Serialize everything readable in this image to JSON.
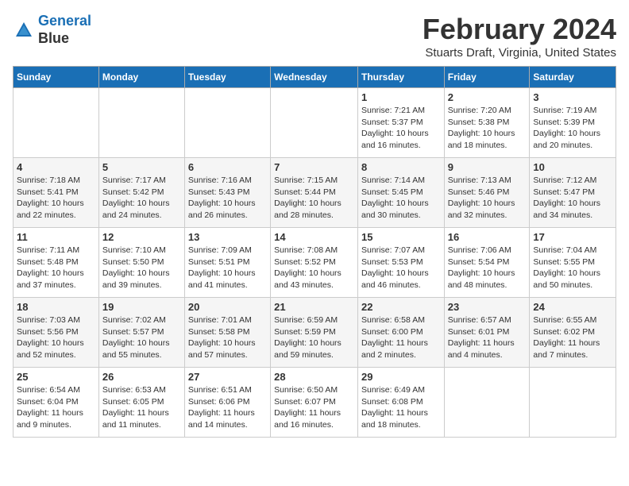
{
  "header": {
    "logo_line1": "General",
    "logo_line2": "Blue",
    "month": "February 2024",
    "location": "Stuarts Draft, Virginia, United States"
  },
  "weekdays": [
    "Sunday",
    "Monday",
    "Tuesday",
    "Wednesday",
    "Thursday",
    "Friday",
    "Saturday"
  ],
  "weeks": [
    [
      {
        "day": "",
        "info": ""
      },
      {
        "day": "",
        "info": ""
      },
      {
        "day": "",
        "info": ""
      },
      {
        "day": "",
        "info": ""
      },
      {
        "day": "1",
        "info": "Sunrise: 7:21 AM\nSunset: 5:37 PM\nDaylight: 10 hours\nand 16 minutes."
      },
      {
        "day": "2",
        "info": "Sunrise: 7:20 AM\nSunset: 5:38 PM\nDaylight: 10 hours\nand 18 minutes."
      },
      {
        "day": "3",
        "info": "Sunrise: 7:19 AM\nSunset: 5:39 PM\nDaylight: 10 hours\nand 20 minutes."
      }
    ],
    [
      {
        "day": "4",
        "info": "Sunrise: 7:18 AM\nSunset: 5:41 PM\nDaylight: 10 hours\nand 22 minutes."
      },
      {
        "day": "5",
        "info": "Sunrise: 7:17 AM\nSunset: 5:42 PM\nDaylight: 10 hours\nand 24 minutes."
      },
      {
        "day": "6",
        "info": "Sunrise: 7:16 AM\nSunset: 5:43 PM\nDaylight: 10 hours\nand 26 minutes."
      },
      {
        "day": "7",
        "info": "Sunrise: 7:15 AM\nSunset: 5:44 PM\nDaylight: 10 hours\nand 28 minutes."
      },
      {
        "day": "8",
        "info": "Sunrise: 7:14 AM\nSunset: 5:45 PM\nDaylight: 10 hours\nand 30 minutes."
      },
      {
        "day": "9",
        "info": "Sunrise: 7:13 AM\nSunset: 5:46 PM\nDaylight: 10 hours\nand 32 minutes."
      },
      {
        "day": "10",
        "info": "Sunrise: 7:12 AM\nSunset: 5:47 PM\nDaylight: 10 hours\nand 34 minutes."
      }
    ],
    [
      {
        "day": "11",
        "info": "Sunrise: 7:11 AM\nSunset: 5:48 PM\nDaylight: 10 hours\nand 37 minutes."
      },
      {
        "day": "12",
        "info": "Sunrise: 7:10 AM\nSunset: 5:50 PM\nDaylight: 10 hours\nand 39 minutes."
      },
      {
        "day": "13",
        "info": "Sunrise: 7:09 AM\nSunset: 5:51 PM\nDaylight: 10 hours\nand 41 minutes."
      },
      {
        "day": "14",
        "info": "Sunrise: 7:08 AM\nSunset: 5:52 PM\nDaylight: 10 hours\nand 43 minutes."
      },
      {
        "day": "15",
        "info": "Sunrise: 7:07 AM\nSunset: 5:53 PM\nDaylight: 10 hours\nand 46 minutes."
      },
      {
        "day": "16",
        "info": "Sunrise: 7:06 AM\nSunset: 5:54 PM\nDaylight: 10 hours\nand 48 minutes."
      },
      {
        "day": "17",
        "info": "Sunrise: 7:04 AM\nSunset: 5:55 PM\nDaylight: 10 hours\nand 50 minutes."
      }
    ],
    [
      {
        "day": "18",
        "info": "Sunrise: 7:03 AM\nSunset: 5:56 PM\nDaylight: 10 hours\nand 52 minutes."
      },
      {
        "day": "19",
        "info": "Sunrise: 7:02 AM\nSunset: 5:57 PM\nDaylight: 10 hours\nand 55 minutes."
      },
      {
        "day": "20",
        "info": "Sunrise: 7:01 AM\nSunset: 5:58 PM\nDaylight: 10 hours\nand 57 minutes."
      },
      {
        "day": "21",
        "info": "Sunrise: 6:59 AM\nSunset: 5:59 PM\nDaylight: 10 hours\nand 59 minutes."
      },
      {
        "day": "22",
        "info": "Sunrise: 6:58 AM\nSunset: 6:00 PM\nDaylight: 11 hours\nand 2 minutes."
      },
      {
        "day": "23",
        "info": "Sunrise: 6:57 AM\nSunset: 6:01 PM\nDaylight: 11 hours\nand 4 minutes."
      },
      {
        "day": "24",
        "info": "Sunrise: 6:55 AM\nSunset: 6:02 PM\nDaylight: 11 hours\nand 7 minutes."
      }
    ],
    [
      {
        "day": "25",
        "info": "Sunrise: 6:54 AM\nSunset: 6:04 PM\nDaylight: 11 hours\nand 9 minutes."
      },
      {
        "day": "26",
        "info": "Sunrise: 6:53 AM\nSunset: 6:05 PM\nDaylight: 11 hours\nand 11 minutes."
      },
      {
        "day": "27",
        "info": "Sunrise: 6:51 AM\nSunset: 6:06 PM\nDaylight: 11 hours\nand 14 minutes."
      },
      {
        "day": "28",
        "info": "Sunrise: 6:50 AM\nSunset: 6:07 PM\nDaylight: 11 hours\nand 16 minutes."
      },
      {
        "day": "29",
        "info": "Sunrise: 6:49 AM\nSunset: 6:08 PM\nDaylight: 11 hours\nand 18 minutes."
      },
      {
        "day": "",
        "info": ""
      },
      {
        "day": "",
        "info": ""
      }
    ]
  ]
}
